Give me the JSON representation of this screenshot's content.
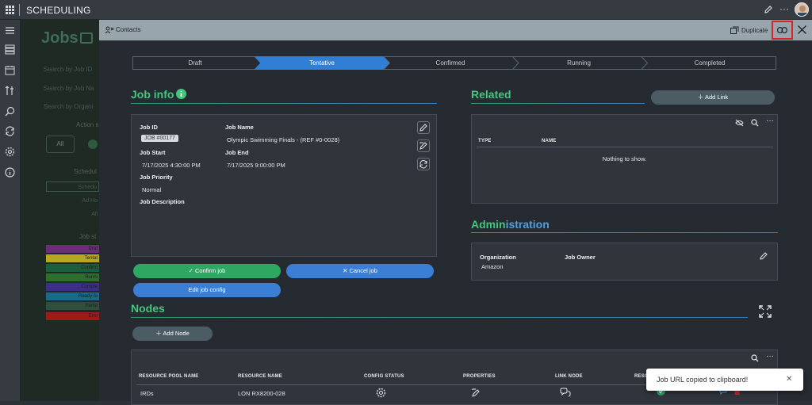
{
  "app": {
    "title": "SCHEDULING"
  },
  "background_page": {
    "title": "Jobs",
    "search": [
      "Search by Job ID",
      "Search by Job Na",
      "Search by Organi"
    ],
    "action_label": "Action s",
    "all_button": "All",
    "schedule_label": "Schedul",
    "schedule_rows": [
      "Schedu",
      "Ad Ho",
      "All"
    ],
    "status_label": "Job st",
    "statuses": [
      "Draf",
      "Tentat",
      "Confirm",
      "Runni",
      "Comple",
      "Ready fo",
      "Partia",
      "Erro"
    ],
    "status_colors": [
      "#6b2f7a",
      "#b7a91d",
      "#1b5e3b",
      "#2e6f2e",
      "#3b2f8a",
      "#1a6a8a",
      "#2f4f3c",
      "#a11a1a"
    ]
  },
  "modal": {
    "header": {
      "title": "Contacts",
      "duplicate_label": "Duplicate"
    },
    "stepper": [
      "Draft",
      "Tentative",
      "Confirmed",
      "Running",
      "Completed"
    ],
    "active_step": 1,
    "job_info": {
      "heading": "Job info",
      "job_id_label": "Job ID",
      "job_id_value": "JOB #00177",
      "job_name_label": "Job Name",
      "job_name_value": "Olympic Swimming Finals - (REF #0-0028)",
      "job_start_label": "Job Start",
      "job_start_value": "7/17/2025 4:30:00 PM",
      "job_end_label": "Job End",
      "job_end_value": "7/17/2025 9:00:00 PM",
      "priority_label": "Job Priority",
      "priority_value": "Normal",
      "description_label": "Job Description"
    },
    "buttons": {
      "confirm": "Confirm job",
      "cancel": "Cancel job",
      "edit_config": "Edit job config"
    },
    "related": {
      "heading": "Related",
      "add_link": "Add Link",
      "columns": [
        "TYPE",
        "NAME"
      ],
      "empty_text": "Nothing to show."
    },
    "administration": {
      "heading_part1": "Admin",
      "heading_part2": "istration",
      "organization_label": "Organization",
      "organization_value": "Amazon",
      "owner_label": "Job Owner"
    },
    "nodes": {
      "heading": "Nodes",
      "add_node": "Add Node",
      "columns": [
        "RESOURCE POOL NAME",
        "RESOURCE NAME",
        "CONFIG STATUS",
        "PROPERTIES",
        "LINK NODE",
        "RESO"
      ],
      "rows": [
        {
          "pool": "IRDs",
          "resource": "LON RX8200-028"
        }
      ]
    }
  },
  "toast": {
    "message": "Job URL copied to clipboard!"
  },
  "colors": {
    "accent_green": "#42c77e",
    "accent_blue": "#4e9fe3",
    "step_active": "#2f7fd6",
    "highlight_red": "#d8222a"
  }
}
